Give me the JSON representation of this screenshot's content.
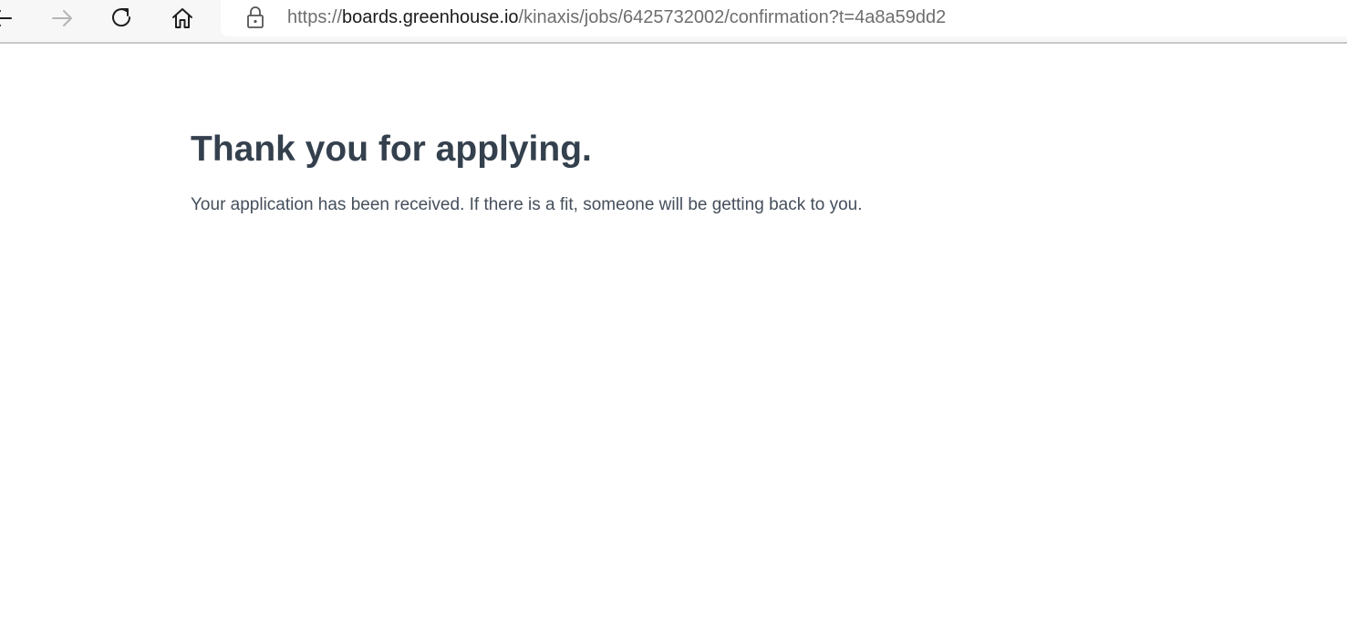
{
  "browser": {
    "url": {
      "scheme": "https://",
      "host": "boards.greenhouse.io",
      "path": "/kinaxis/jobs/6425732002/confirmation?t=4a8a59dd2"
    },
    "icons": {
      "back": "arrow-left-icon",
      "forward": "arrow-right-icon",
      "refresh": "refresh-icon",
      "home": "home-icon",
      "lock": "lock-icon"
    }
  },
  "page": {
    "heading": "Thank you for applying.",
    "message": "Your application has been received. If there is a fit, someone will be getting back to you."
  },
  "colors": {
    "heading": "#34404d",
    "text": "#454f5b",
    "toolbar": "#f7f7f7"
  }
}
